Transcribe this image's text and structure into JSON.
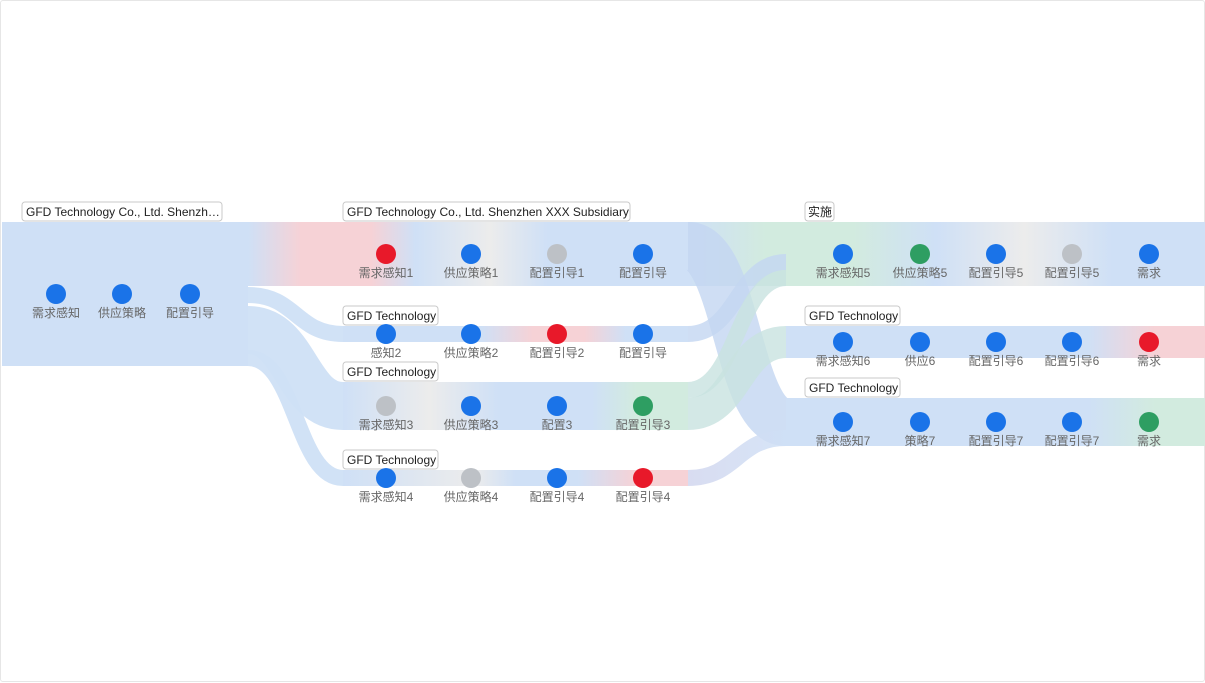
{
  "colors": {
    "band": "#cfe0f6",
    "blue": "#1a73e8",
    "red": "#e8192a",
    "grey": "#bdc1c6",
    "green": "#2e9e62",
    "band_red": "#f6d2d6",
    "band_grey": "#ececec",
    "band_green": "#d2ebdf"
  },
  "groups": [
    {
      "title": "GFD Technology Co., Ltd. Shenzh…",
      "nodes": [
        {
          "label": "需求感知",
          "status": "blue"
        },
        {
          "label": "供应策略",
          "status": "blue"
        },
        {
          "label": "配置引导",
          "status": "blue"
        }
      ]
    },
    {
      "title": "GFD Technology Co., Ltd. Shenzhen XXX Subsidiary",
      "nodes": [
        {
          "label": "需求感知1",
          "status": "red"
        },
        {
          "label": "供应策略1",
          "status": "blue"
        },
        {
          "label": "配置引导1",
          "status": "grey"
        },
        {
          "label": "配置引导",
          "status": "blue"
        }
      ]
    },
    {
      "title": "GFD Technology",
      "nodes": [
        {
          "label": "感知2",
          "status": "blue"
        },
        {
          "label": "供应策略2",
          "status": "blue"
        },
        {
          "label": "配置引导2",
          "status": "red"
        },
        {
          "label": "配置引导",
          "status": "blue"
        }
      ]
    },
    {
      "title": "GFD Technology",
      "nodes": [
        {
          "label": "需求感知3",
          "status": "grey"
        },
        {
          "label": "供应策略3",
          "status": "blue"
        },
        {
          "label": "配置3",
          "status": "blue"
        },
        {
          "label": "配置引导3",
          "status": "green"
        }
      ]
    },
    {
      "title": "GFD Technology",
      "nodes": [
        {
          "label": "需求感知4",
          "status": "blue"
        },
        {
          "label": "供应策略4",
          "status": "grey"
        },
        {
          "label": "配置引导4",
          "status": "blue"
        },
        {
          "label": "配置引导4",
          "status": "red"
        }
      ]
    },
    {
      "title": "实施",
      "nodes": [
        {
          "label": "需求感知5",
          "status": "blue"
        },
        {
          "label": "供应策略5",
          "status": "green"
        },
        {
          "label": "配置引导5",
          "status": "blue"
        },
        {
          "label": "配置引导5",
          "status": "grey"
        },
        {
          "label": "需求",
          "status": "blue"
        }
      ]
    },
    {
      "title": "GFD Technology",
      "nodes": [
        {
          "label": "需求感知6",
          "status": "blue"
        },
        {
          "label": "供应6",
          "status": "blue"
        },
        {
          "label": "配置引导6",
          "status": "blue"
        },
        {
          "label": "配置引导6",
          "status": "blue"
        },
        {
          "label": "需求",
          "status": "red"
        }
      ]
    },
    {
      "title": "GFD Technology",
      "nodes": [
        {
          "label": "需求感知7",
          "status": "blue"
        },
        {
          "label": "策略7",
          "status": "blue"
        },
        {
          "label": "配置引导7",
          "status": "blue"
        },
        {
          "label": "配置引导7",
          "status": "blue"
        },
        {
          "label": "需求",
          "status": "green"
        }
      ]
    }
  ]
}
